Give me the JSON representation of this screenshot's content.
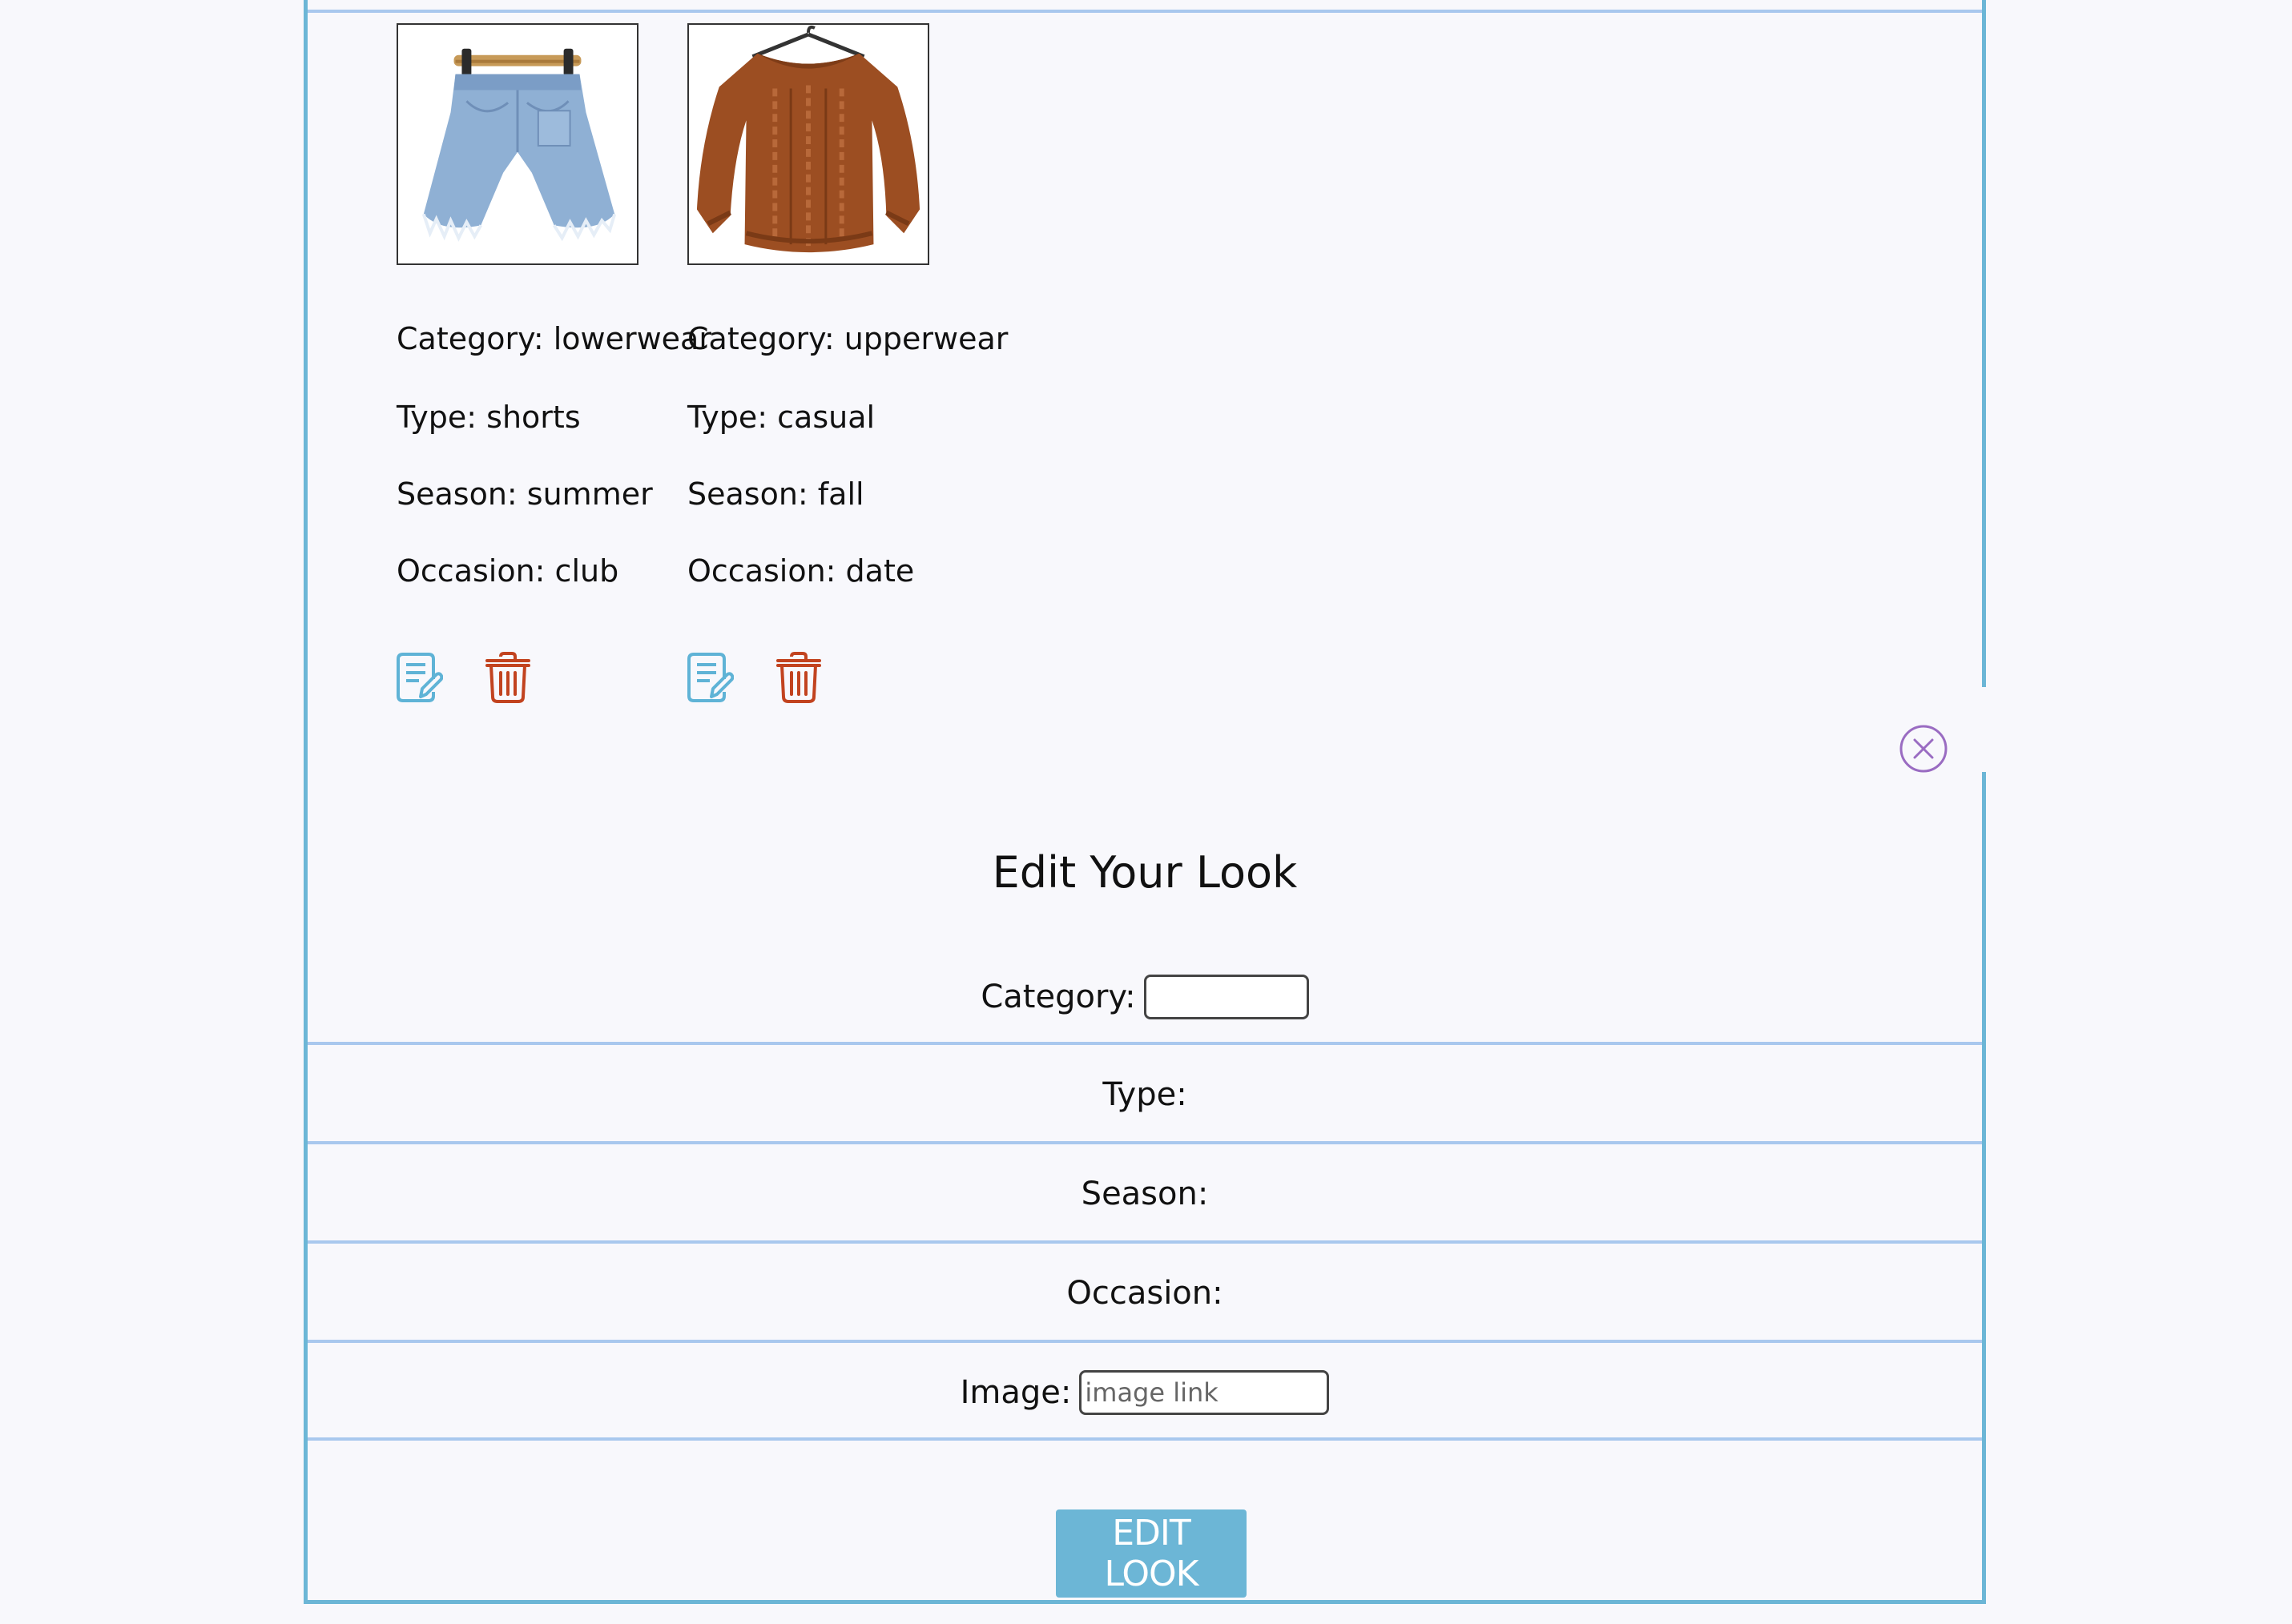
{
  "items": [
    {
      "image_icon": "denim-shorts-image",
      "category": "Category: lowerwear",
      "type": "Type: shorts",
      "season": "Season: summer",
      "occasion": "Occasion: club",
      "edit_icon": "edit-document-icon",
      "delete_icon": "trash-icon"
    },
    {
      "image_icon": "brown-sweater-image",
      "category": "Category: upperwear",
      "type": "Type: casual",
      "season": "Season: fall",
      "occasion": "Occasion: date",
      "edit_icon": "edit-document-icon",
      "delete_icon": "trash-icon"
    }
  ],
  "modal": {
    "title": "Edit Your Look",
    "close_icon": "close-circle-icon",
    "fields": {
      "category_label": "Category:",
      "category_value": "",
      "type_label": "Type:",
      "season_label": "Season:",
      "occasion_label": "Occasion:",
      "image_label": "Image:",
      "image_value": "",
      "image_placeholder": "image link"
    },
    "submit_label": "EDIT LOOK"
  },
  "colors": {
    "frame_border": "#6cb6d6",
    "divider": "#a9c8ee",
    "edit_icon": "#5fb3d6",
    "delete_icon": "#c2431f",
    "close_icon": "#9a6cc2",
    "button_bg": "#6cb6d6",
    "background": "#f8f8fc"
  }
}
